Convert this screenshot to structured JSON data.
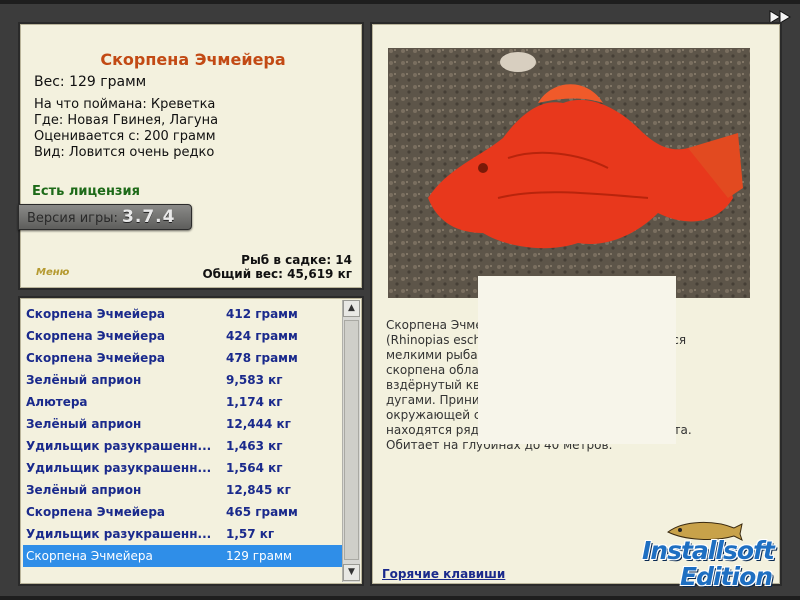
{
  "fish": {
    "name": "Скорпена Эчмейера",
    "weight": "Вес: 129 грамм",
    "bait": "На что поймана: Креветка",
    "location": "Где: Новая Гвинея, Лагуна",
    "value": "Оценивается с: 200 грамм",
    "rarity": "Вид: Ловится очень редко"
  },
  "license": "Есть лицензия",
  "version": {
    "label": "Версия игры:",
    "number": "3.7.4"
  },
  "menu_logo": "Меню",
  "cage": {
    "count": "Рыб в садке: 14",
    "total": "Общий вес: 45,619 кг"
  },
  "catches": [
    {
      "name": "Скорпена Эчмейера",
      "weight": "412 грамм"
    },
    {
      "name": "Скорпена Эчмейера",
      "weight": "424 грамм"
    },
    {
      "name": "Скорпена Эчмейера",
      "weight": "478 грамм"
    },
    {
      "name": "Зелёный априон",
      "weight": "9,583 кг"
    },
    {
      "name": "Алютера",
      "weight": "1,174 кг"
    },
    {
      "name": "Зелёный априон",
      "weight": "12,444 кг"
    },
    {
      "name": "Удильщик разукрашенн...",
      "weight": "1,463 кг"
    },
    {
      "name": "Удильщик разукрашенн...",
      "weight": "1,564 кг"
    },
    {
      "name": "Зелёный априон",
      "weight": "12,845 кг"
    },
    {
      "name": "Скорпена Эчмейера",
      "weight": "465 грамм"
    },
    {
      "name": "Удильщик разукрашенн...",
      "weight": "1,57 кг"
    },
    {
      "name": "Скорпена Эчмейера",
      "weight": "129 грамм"
    }
  ],
  "description": {
    "lines": [
      "Скорпена Эчмейера (Paddle-flap Scorpionfish",
      "(Rhinopias eschmeyeri)) – редкий вид. Питается",
      "мелкими рыбами и ракообразными. Эта",
      "скорпена облада­ет особенностью -",
      "вздёрнутый кверху нос и бровными",
      "дугами. Принимая окраску",
      "окружающей среды, скорпены",
      "находятся рядом с кораллами такого же цвета.",
      "Обитает на глубинах до 40 метров."
    ]
  },
  "hotkeys": "Горячие клавиши",
  "edition": {
    "line1": "Installsoft",
    "line2": "Edition"
  },
  "icons": {
    "fast_forward": "fast-forward-icon",
    "scroll_up": "chevron-up-icon",
    "scroll_down": "chevron-down-icon"
  },
  "colors": {
    "panel_bg": "#f3f1de",
    "title": "#c24a14",
    "list_text": "#1a2a8c",
    "license": "#1d6a18",
    "selected_row": "#2f8ee8",
    "fish_red": "#e8381c"
  }
}
